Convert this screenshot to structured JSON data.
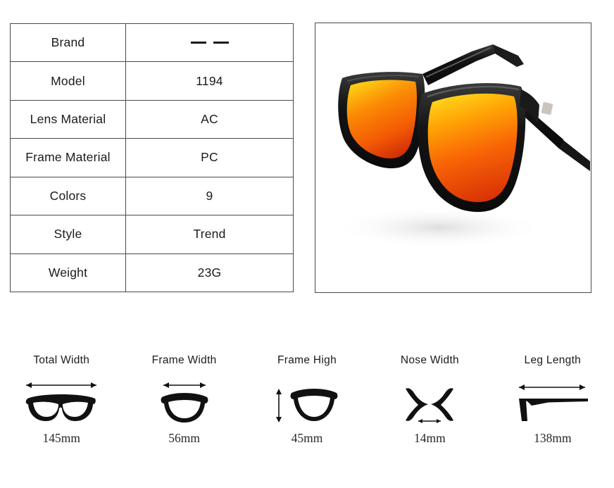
{
  "spec_table": {
    "rows": [
      {
        "label": "Brand",
        "value": "— —",
        "is_blank": true
      },
      {
        "label": "Model",
        "value": "1194",
        "is_blank": false
      },
      {
        "label": "Lens Material",
        "value": "AC",
        "is_blank": false
      },
      {
        "label": "Frame Material",
        "value": "PC",
        "is_blank": false
      },
      {
        "label": "Colors",
        "value": "9",
        "is_blank": false
      },
      {
        "label": "Style",
        "value": "Trend",
        "is_blank": false
      },
      {
        "label": "Weight",
        "value": "23G",
        "is_blank": false
      }
    ]
  },
  "product_photo": {
    "alt": "black framed sunglasses with orange mirrored lenses",
    "frame_color": "#141414",
    "frame_highlight": "#4d4d4d",
    "lens_color_top": "#ffc412",
    "lens_color_mid": "#fb7008",
    "lens_color_bottom": "#e03a08",
    "background": "#ffffff",
    "shadow_color": "#e8e8e8"
  },
  "measurements": [
    {
      "title": "Total Width",
      "value": "145mm",
      "icon": "full-glasses-icon",
      "arrow": "horizontal"
    },
    {
      "title": "Frame Width",
      "value": "56mm",
      "icon": "single-lens-icon",
      "arrow": "horizontal"
    },
    {
      "title": "Frame High",
      "value": "45mm",
      "icon": "single-lens-icon",
      "arrow": "vertical"
    },
    {
      "title": "Nose Width",
      "value": "14mm",
      "icon": "nose-bridge-icon",
      "arrow": "horizontal-small"
    },
    {
      "title": "Leg Length",
      "value": "138mm",
      "icon": "temple-arm-icon",
      "arrow": "horizontal"
    }
  ],
  "colors": {
    "table_border": "#4a4a4a",
    "text": "#1b1b1b",
    "icon": "#111111"
  }
}
